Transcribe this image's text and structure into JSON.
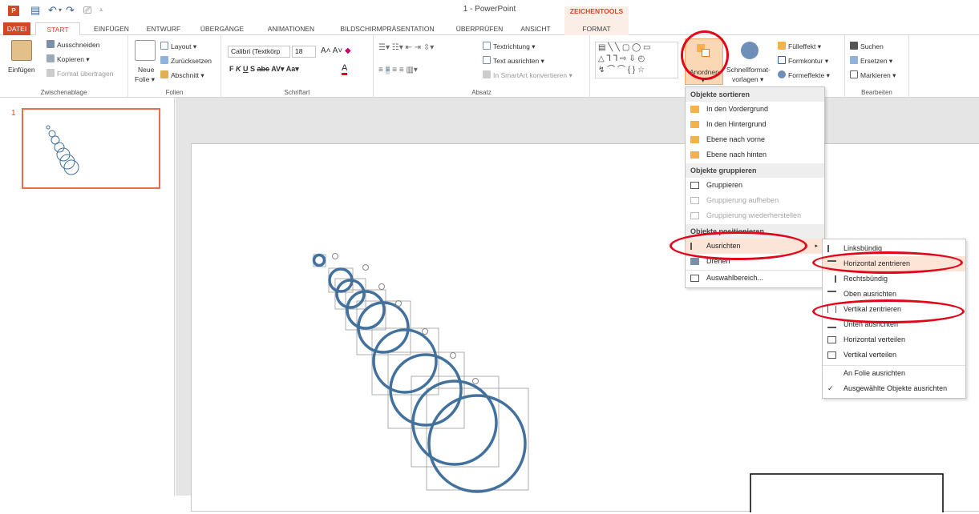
{
  "app": {
    "title": "1 - PowerPoint",
    "context_group": "ZEICHENTOOLS"
  },
  "qat": {
    "icons": [
      "powerpoint-logo",
      "save-icon",
      "undo-icon",
      "redo-icon",
      "presenter-icon",
      "customize-icon"
    ]
  },
  "tabs": [
    {
      "label": "DATEI"
    },
    {
      "label": "START"
    },
    {
      "label": "EINFÜGEN"
    },
    {
      "label": "ENTWURF"
    },
    {
      "label": "ÜBERGÄNGE"
    },
    {
      "label": "ANIMATIONEN"
    },
    {
      "label": "BILDSCHIRMPRÄSENTATION"
    },
    {
      "label": "ÜBERPRÜFEN"
    },
    {
      "label": "ANSICHT"
    },
    {
      "label": "FORMAT"
    }
  ],
  "ribbon": {
    "clipboard": {
      "label": "Zwischenablage",
      "paste": "Einfügen",
      "cut": "Ausschneiden",
      "copy": "Kopieren",
      "painter": "Format übertragen"
    },
    "slides": {
      "label": "Folien",
      "new1": "Neue",
      "new2": "Folie",
      "layout": "Layout",
      "reset": "Zurücksetzen",
      "section": "Abschnitt"
    },
    "font": {
      "label": "Schriftart",
      "family": "Calibri (Textkörp",
      "size": "18"
    },
    "paragraph": {
      "label": "Absatz",
      "text_direction": "Textrichtung",
      "align_text": "Text ausrichten",
      "smartart": "In SmartArt konvertieren"
    },
    "drawing": {
      "arrange": "Anordnen",
      "quick1": "Schnellformat-",
      "quick2": "vorlagen",
      "fill": "Fülleffekt",
      "outline": "Formkontur",
      "effects": "Formeffekte"
    },
    "editing": {
      "label": "Bearbeiten",
      "find": "Suchen",
      "replace": "Ersetzen",
      "select": "Markieren"
    }
  },
  "thumbnail": {
    "number": "1"
  },
  "arrange_menu": {
    "sort_header": "Objekte sortieren",
    "items_sort": [
      "In den Vordergrund",
      "In den Hintergrund",
      "Ebene nach vorne",
      "Ebene nach hinten"
    ],
    "group_header": "Objekte gruppieren",
    "items_group": [
      "Gruppieren",
      "Gruppierung aufheben",
      "Gruppierung wiederherstellen"
    ],
    "position_header": "Objekte positionieren",
    "align": "Ausrichten",
    "rotate": "Drehen",
    "selection": "Auswahlbereich..."
  },
  "align_menu": {
    "items": [
      "Linksbündig",
      "Horizontal zentrieren",
      "Rechtsbündig",
      "Oben ausrichten",
      "Vertikal zentrieren",
      "Unten ausrichten",
      "Horizontal verteilen",
      "Vertikal verteilen",
      "An Folie ausrichten",
      "Ausgewählte Objekte ausrichten"
    ]
  },
  "colors": {
    "accent": "#d24726",
    "circle": "#41719c",
    "highlight": "#fce4d6",
    "annotation": "#e2061b"
  }
}
